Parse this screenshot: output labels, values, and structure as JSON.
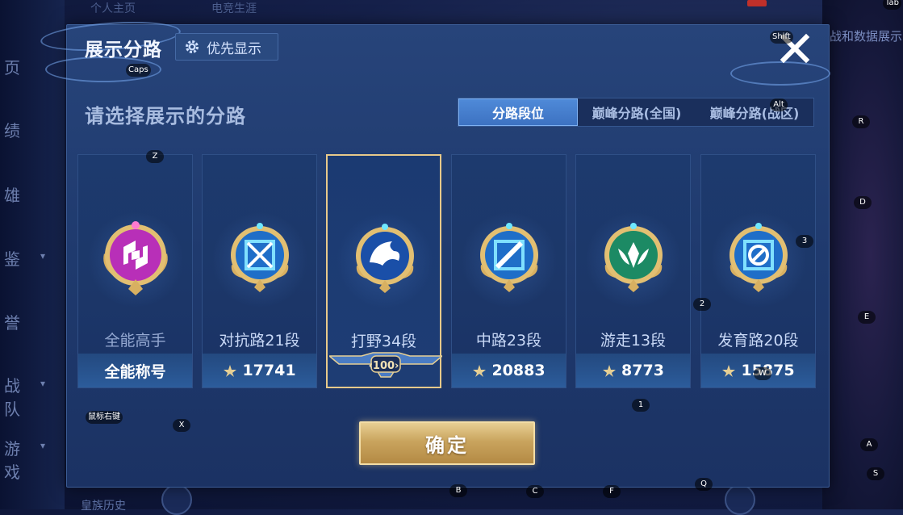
{
  "background": {
    "top_tabs": [
      "个人主页",
      "电竞生涯"
    ],
    "top_right_text": "战和数据展示",
    "left_nav": [
      "页",
      "绩",
      "雄",
      "鉴",
      "誉",
      "战队",
      "游戏"
    ],
    "bottom_text": "皇族历史"
  },
  "dialog": {
    "title": "展示分路",
    "priority_label": "优先显示",
    "subtitle": "请选择展示的分路",
    "close_icon": "close-icon"
  },
  "tabs": [
    {
      "label": "分路段位",
      "active": true
    },
    {
      "label": "巅峰分路(全国)",
      "active": false
    },
    {
      "label": "巅峰分路(战区)",
      "active": false
    }
  ],
  "cards": [
    {
      "rank": "全能高手",
      "bottom": "全能称号",
      "emblem": "allround-emblem-icon",
      "color": "#c93fc6"
    },
    {
      "rank": "对抗路21段",
      "bottom": "17741",
      "emblem": "clash-lane-emblem-icon",
      "color": "#3fa8e8"
    },
    {
      "rank": "打野34段",
      "bottom": "100",
      "emblem": "jungle-emblem-icon",
      "color": "#2f6fd0",
      "selected": true
    },
    {
      "rank": "中路23段",
      "bottom": "20883",
      "emblem": "mid-lane-emblem-icon",
      "color": "#3fa8e8"
    },
    {
      "rank": "游走13段",
      "bottom": "8773",
      "emblem": "roam-emblem-icon",
      "color": "#2fa878"
    },
    {
      "rank": "发育路20段",
      "bottom": "15875",
      "emblem": "farm-lane-emblem-icon",
      "color": "#3fa8e8"
    }
  ],
  "confirm_label": "确定",
  "key_hints": {
    "caps": "Caps",
    "shift": "Shift",
    "alt": "Alt",
    "tab": "Tab",
    "z": "Z",
    "x": "X",
    "r": "R",
    "d": "D",
    "e": "E",
    "three": "3",
    "two": "2",
    "one": "1",
    "w": "W",
    "a": "A",
    "s": "S",
    "q": "Q",
    "b": "B",
    "c": "C",
    "f": "F",
    "mouse_right": "鼠标右键"
  }
}
